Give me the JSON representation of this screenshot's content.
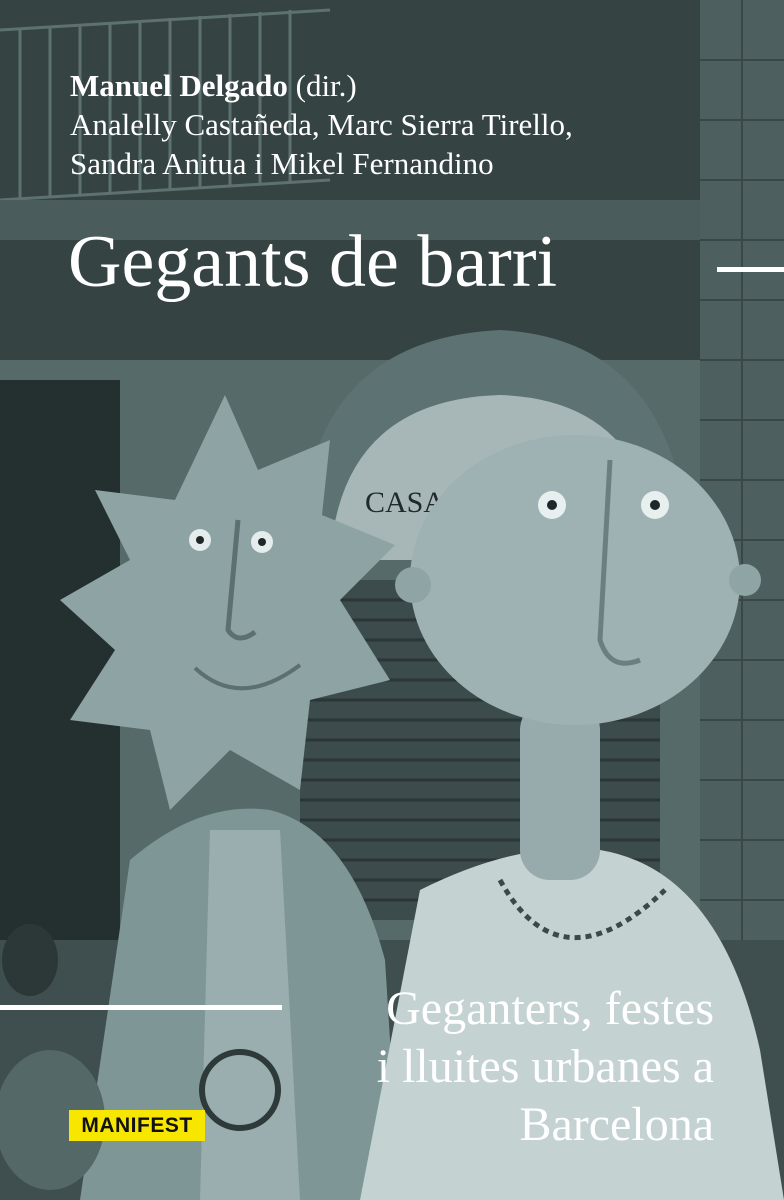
{
  "cover": {
    "authors": {
      "lead": "Manuel Delgado",
      "lead_role": " (dir.)",
      "line2": "Analelly Castañeda, Marc Sierra Tirello,",
      "line3": "Sandra Anitua i Mikel Fernandino"
    },
    "title": "Gegants de barri",
    "subtitle_lines": [
      "Geganters, festes",
      "i lluites urbanes a",
      "Barcelona"
    ],
    "publisher": "MANIFEST",
    "photo": {
      "shop_sign": "CASA TO"
    }
  },
  "colors": {
    "text": "#ffffff",
    "duotone_dark": "#2f3b3b",
    "duotone_mid": "#7a9091",
    "duotone_light": "#b4c3c3",
    "publisher_badge": "#f7e600"
  }
}
